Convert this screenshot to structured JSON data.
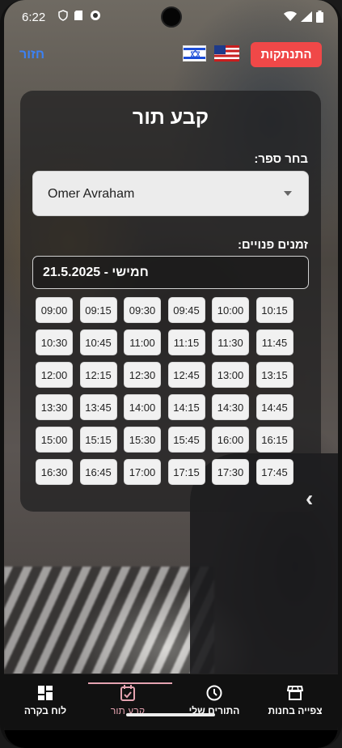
{
  "status_bar": {
    "time": "6:22"
  },
  "top_bar": {
    "back_label": "חזור",
    "logout_label": "התנתקות"
  },
  "card": {
    "title": "קבע תור",
    "barber_label": "בחר ספר:",
    "barber_value": "Omer Avraham",
    "times_label": "זמנים פנויים:",
    "date_value": "חמישי - 21.5.2025"
  },
  "slots": [
    "09:00",
    "09:15",
    "09:30",
    "09:45",
    "10:00",
    "10:15",
    "10:30",
    "10:45",
    "11:00",
    "11:15",
    "11:30",
    "11:45",
    "12:00",
    "12:15",
    "12:30",
    "12:45",
    "13:00",
    "13:15",
    "13:30",
    "13:45",
    "14:00",
    "14:15",
    "14:30",
    "14:45",
    "15:00",
    "15:15",
    "15:30",
    "15:45",
    "16:00",
    "16:15",
    "16:30",
    "16:45",
    "17:00",
    "17:15",
    "17:30",
    "17:45"
  ],
  "bottom_nav": {
    "dashboard": "לוח בקרה",
    "book": "קבע תור",
    "my_appointments": "התורים שלי",
    "view_shops": "צפייה בחנות"
  },
  "colors": {
    "accent_logout": "#f04848",
    "accent_back": "#3b82f6",
    "nav_active": "#e4a3b0"
  },
  "icons": {
    "nav_dashboard": "grid-icon",
    "nav_book": "calendar-check-icon",
    "nav_appointments": "clock-icon",
    "nav_shops": "storefront-icon"
  }
}
